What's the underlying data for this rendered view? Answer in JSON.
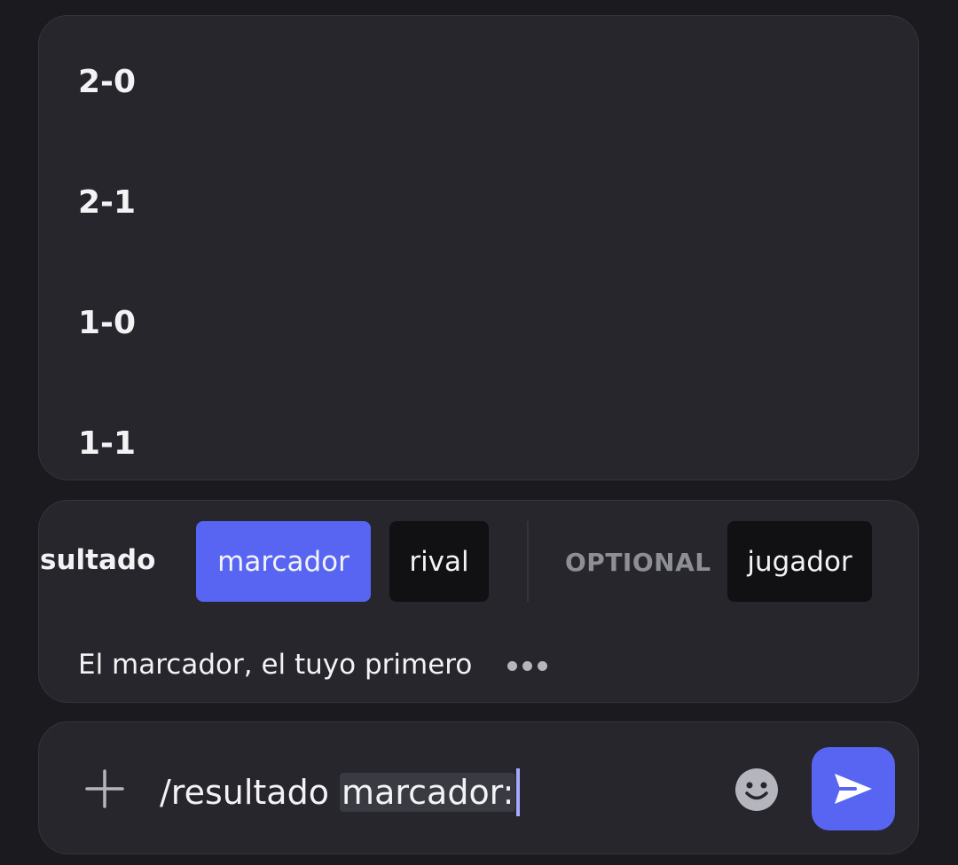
{
  "options": [
    "2-0",
    "2-1",
    "1-0",
    "1-1"
  ],
  "params": {
    "command_name": "esultado",
    "required": [
      {
        "label": "marcador",
        "active": true
      },
      {
        "label": "rival",
        "active": false
      }
    ],
    "optional_label": "OPTIONAL",
    "optional": [
      {
        "label": "jugador",
        "active": false
      }
    ],
    "description": "El marcador, el tuyo primero"
  },
  "input": {
    "command_text": "/resultado ",
    "param_text": "marcador:"
  },
  "icons": {
    "add": "plus-icon",
    "emoji": "emoji-icon",
    "send": "send-icon",
    "more": "more-dots-icon"
  },
  "colors": {
    "accent": "#5865f2",
    "panel": "#26262c",
    "background": "#1b1b1f"
  }
}
